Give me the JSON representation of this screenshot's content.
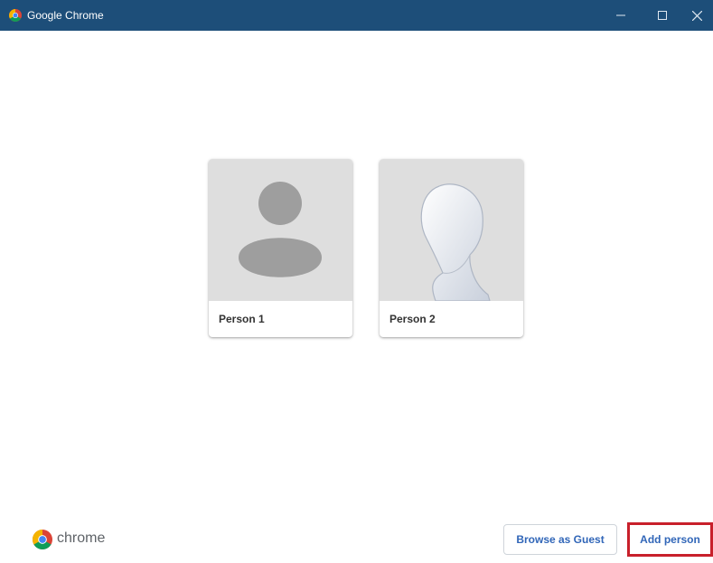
{
  "window": {
    "title": "Google Chrome",
    "icons": {
      "app": "chrome-icon",
      "minimize": "minimize-icon",
      "maximize": "maximize-icon",
      "close": "close-icon"
    },
    "titlebar_color": "#1d4e79"
  },
  "profiles": [
    {
      "name": "Person 1",
      "avatar": "generic-avatar"
    },
    {
      "name": "Person 2",
      "avatar": "mannequin-avatar"
    }
  ],
  "footer": {
    "logo_text": "chrome",
    "guest_label": "Browse as Guest",
    "add_label": "Add person"
  },
  "colors": {
    "accent_blue": "#3166b8",
    "highlight_red": "#c8202b"
  }
}
